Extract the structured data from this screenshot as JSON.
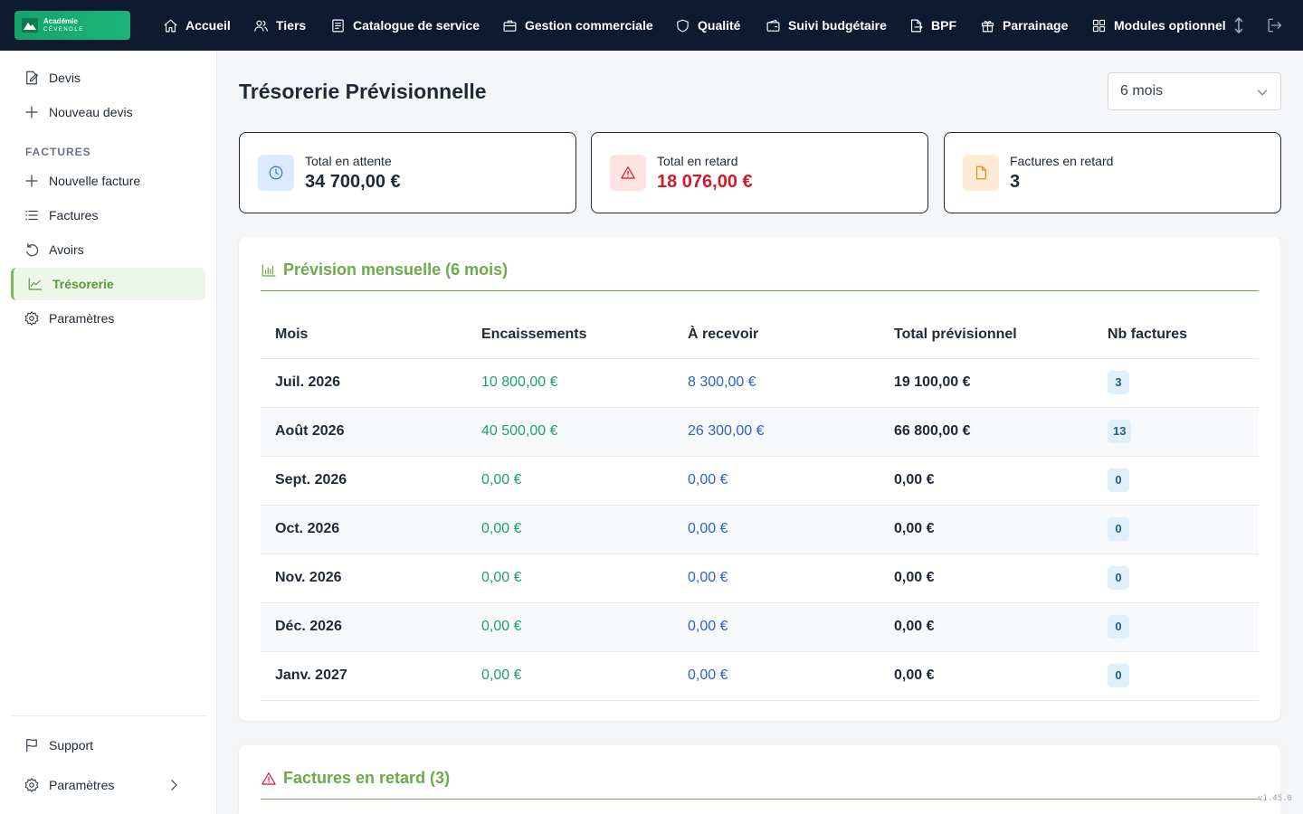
{
  "brand": {
    "line1": "Académie",
    "line2": "CÉVENOLE",
    "color": "#16a36a"
  },
  "topnav": {
    "items": [
      {
        "label": "Accueil",
        "icon": "home-icon"
      },
      {
        "label": "Tiers",
        "icon": "users-icon"
      },
      {
        "label": "Catalogue de service",
        "icon": "catalog-icon"
      },
      {
        "label": "Gestion commerciale",
        "icon": "briefcase-icon"
      },
      {
        "label": "Qualité",
        "icon": "shield-icon"
      },
      {
        "label": "Suivi budgétaire",
        "icon": "wallet-icon"
      },
      {
        "label": "BPF",
        "icon": "document-arrow-icon"
      },
      {
        "label": "Parrainage",
        "icon": "gift-icon"
      },
      {
        "label": "Modules optionnel",
        "icon": "grid-icon"
      }
    ]
  },
  "sidebar": {
    "items_top": [
      {
        "label": "Devis",
        "icon": "edit-document-icon"
      },
      {
        "label": "Nouveau devis",
        "icon": "plus-icon"
      }
    ],
    "section": "FACTURES",
    "items_factures": [
      {
        "label": "Nouvelle facture",
        "icon": "plus-icon"
      },
      {
        "label": "Factures",
        "icon": "list-icon"
      },
      {
        "label": "Avoirs",
        "icon": "undo-icon"
      },
      {
        "label": "Trésorerie",
        "icon": "chart-line-icon",
        "active": true
      },
      {
        "label": "Paramètres",
        "icon": "gear-icon"
      }
    ],
    "bottom": [
      {
        "label": "Support",
        "icon": "flag-icon"
      },
      {
        "label": "Paramètres",
        "icon": "gear-icon"
      }
    ]
  },
  "page": {
    "title": "Trésorerie Prévisionnelle",
    "period": "6 mois"
  },
  "stats": [
    {
      "label": "Total en attente",
      "value": "34 700,00 €",
      "icon": "clock-icon",
      "color": "#1f2937"
    },
    {
      "label": "Total en retard",
      "value": "18 076,00 €",
      "icon": "warning-icon",
      "color": "#d11a2a"
    },
    {
      "label": "Factures en retard",
      "value": "3",
      "icon": "file-icon",
      "color": "#1f2937"
    }
  ],
  "forecast": {
    "title": "Prévision mensuelle (6 mois)",
    "headers": [
      "Mois",
      "Encaissements",
      "À recevoir",
      "Total prévisionnel",
      "Nb factures"
    ],
    "rows": [
      {
        "mois": "Juil. 2026",
        "encaissements": "10 800,00 €",
        "a_recevoir": "8 300,00 €",
        "total": "19 100,00 €",
        "nb": "3"
      },
      {
        "mois": "Août 2026",
        "encaissements": "40 500,00 €",
        "a_recevoir": "26 300,00 €",
        "total": "66 800,00 €",
        "nb": "13"
      },
      {
        "mois": "Sept. 2026",
        "encaissements": "0,00 €",
        "a_recevoir": "0,00 €",
        "total": "0,00 €",
        "nb": "0"
      },
      {
        "mois": "Oct. 2026",
        "encaissements": "0,00 €",
        "a_recevoir": "0,00 €",
        "total": "0,00 €",
        "nb": "0"
      },
      {
        "mois": "Nov. 2026",
        "encaissements": "0,00 €",
        "a_recevoir": "0,00 €",
        "total": "0,00 €",
        "nb": "0"
      },
      {
        "mois": "Déc. 2026",
        "encaissements": "0,00 €",
        "a_recevoir": "0,00 €",
        "total": "0,00 €",
        "nb": "0"
      },
      {
        "mois": "Janv. 2027",
        "encaissements": "0,00 €",
        "a_recevoir": "0,00 €",
        "total": "0,00 €",
        "nb": "0"
      }
    ]
  },
  "overdue": {
    "title": "Factures en retard (3)"
  },
  "version": "v1.45.0"
}
